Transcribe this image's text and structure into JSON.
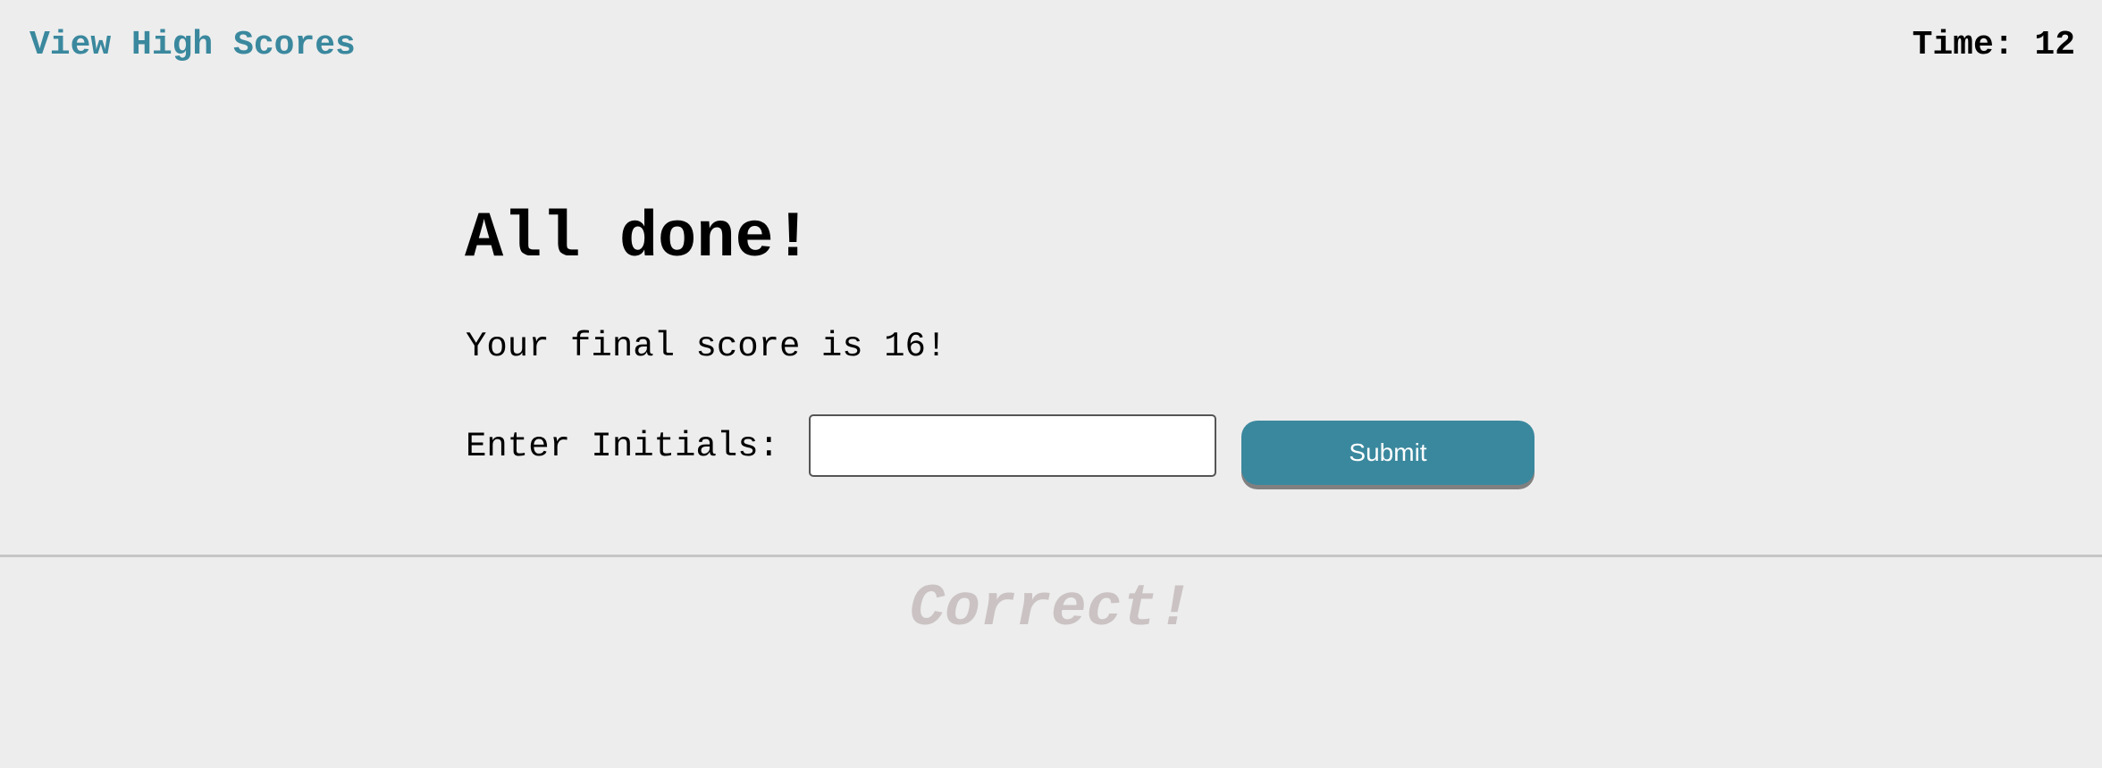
{
  "header": {
    "high_scores_link": "View High Scores",
    "timer_label": "Time:",
    "timer_value": "12"
  },
  "main": {
    "title": "All done!",
    "score_message": "Your final score is 16!",
    "initials_label": "Enter Initials:",
    "initials_value": "",
    "initials_placeholder": "",
    "submit_label": "Submit"
  },
  "feedback": {
    "text": "Correct!"
  },
  "colors": {
    "background": "#ededed",
    "accent": "#3a889e",
    "divider": "#c6c6c6",
    "feedback_text": "#cbc3c3",
    "button_shadow": "#808080"
  }
}
